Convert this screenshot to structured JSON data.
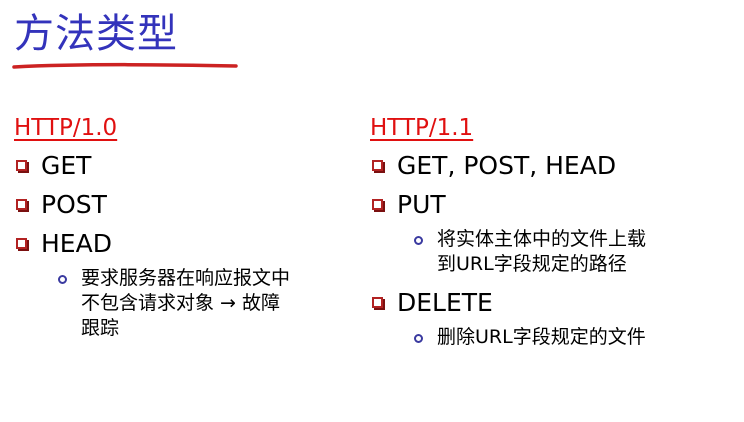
{
  "title": "方法类型",
  "left": {
    "header": "HTTP/1.0",
    "items": [
      "GET",
      "POST",
      "HEAD"
    ],
    "sub_lines": [
      "要求服务器在响应报文中",
      "不包含请求对象 → 故障",
      "跟踪"
    ]
  },
  "right": {
    "header": "HTTP/1.1",
    "items": [
      "GET, POST, HEAD",
      "PUT",
      "DELETE"
    ],
    "put_sub_lines": [
      "将实体主体中的文件上载",
      "到URL字段规定的路径"
    ],
    "delete_sub_lines": [
      "删除URL字段规定的文件"
    ]
  },
  "colors": {
    "title": "#3333bb",
    "header": "#e01010",
    "underline": "#cc2222",
    "square_bullet": "#b22222",
    "circle_bullet": "#3a3aa0"
  }
}
